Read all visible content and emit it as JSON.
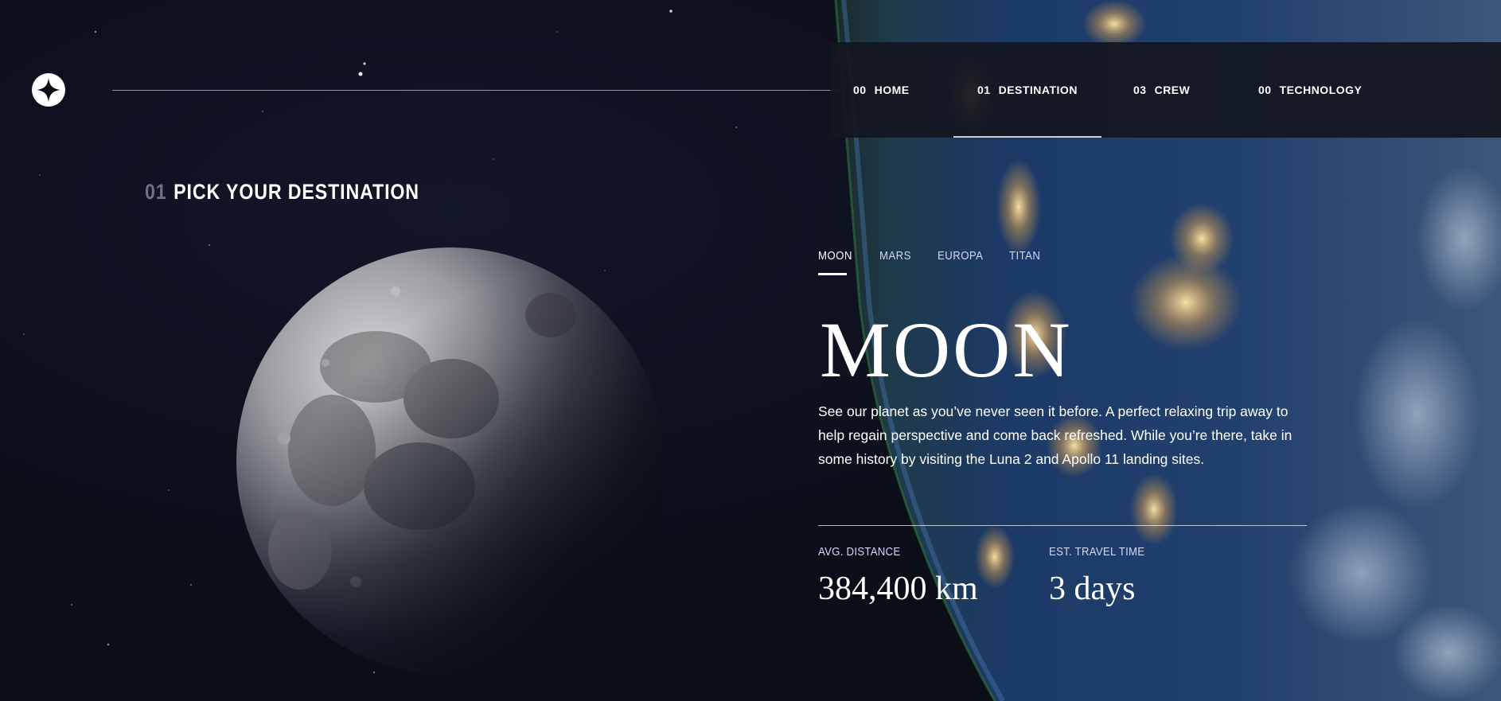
{
  "header": {
    "logo_icon": "star-compass-icon",
    "nav": [
      {
        "num": "00",
        "label": "HOME",
        "active": false
      },
      {
        "num": "01",
        "label": "DESTINATION",
        "active": true
      },
      {
        "num": "03",
        "label": "CREW",
        "active": false
      },
      {
        "num": "00",
        "label": "TECHNOLOGY",
        "active": false
      }
    ]
  },
  "page": {
    "heading_num": "01",
    "heading_text": "PICK YOUR DESTINATION"
  },
  "destination": {
    "tabs": [
      "MOON",
      "MARS",
      "EUROPA",
      "TITAN"
    ],
    "active_tab": "MOON",
    "name": "MOON",
    "description": "See our planet as you’ve never seen it before. A perfect relaxing trip away to help regain perspective and come back refreshed. While you’re there, take in some history by visiting the Luna 2 and Apollo 11 landing sites.",
    "stats": [
      {
        "label": "AVG. DISTANCE",
        "value": "384,400 km"
      },
      {
        "label": "EST. TRAVEL TIME",
        "value": "3 days"
      }
    ]
  },
  "colors": {
    "background": "#0b0d17",
    "nav_background": "#141620",
    "light_text": "#d0d6f9",
    "accent": "#ffffff"
  }
}
